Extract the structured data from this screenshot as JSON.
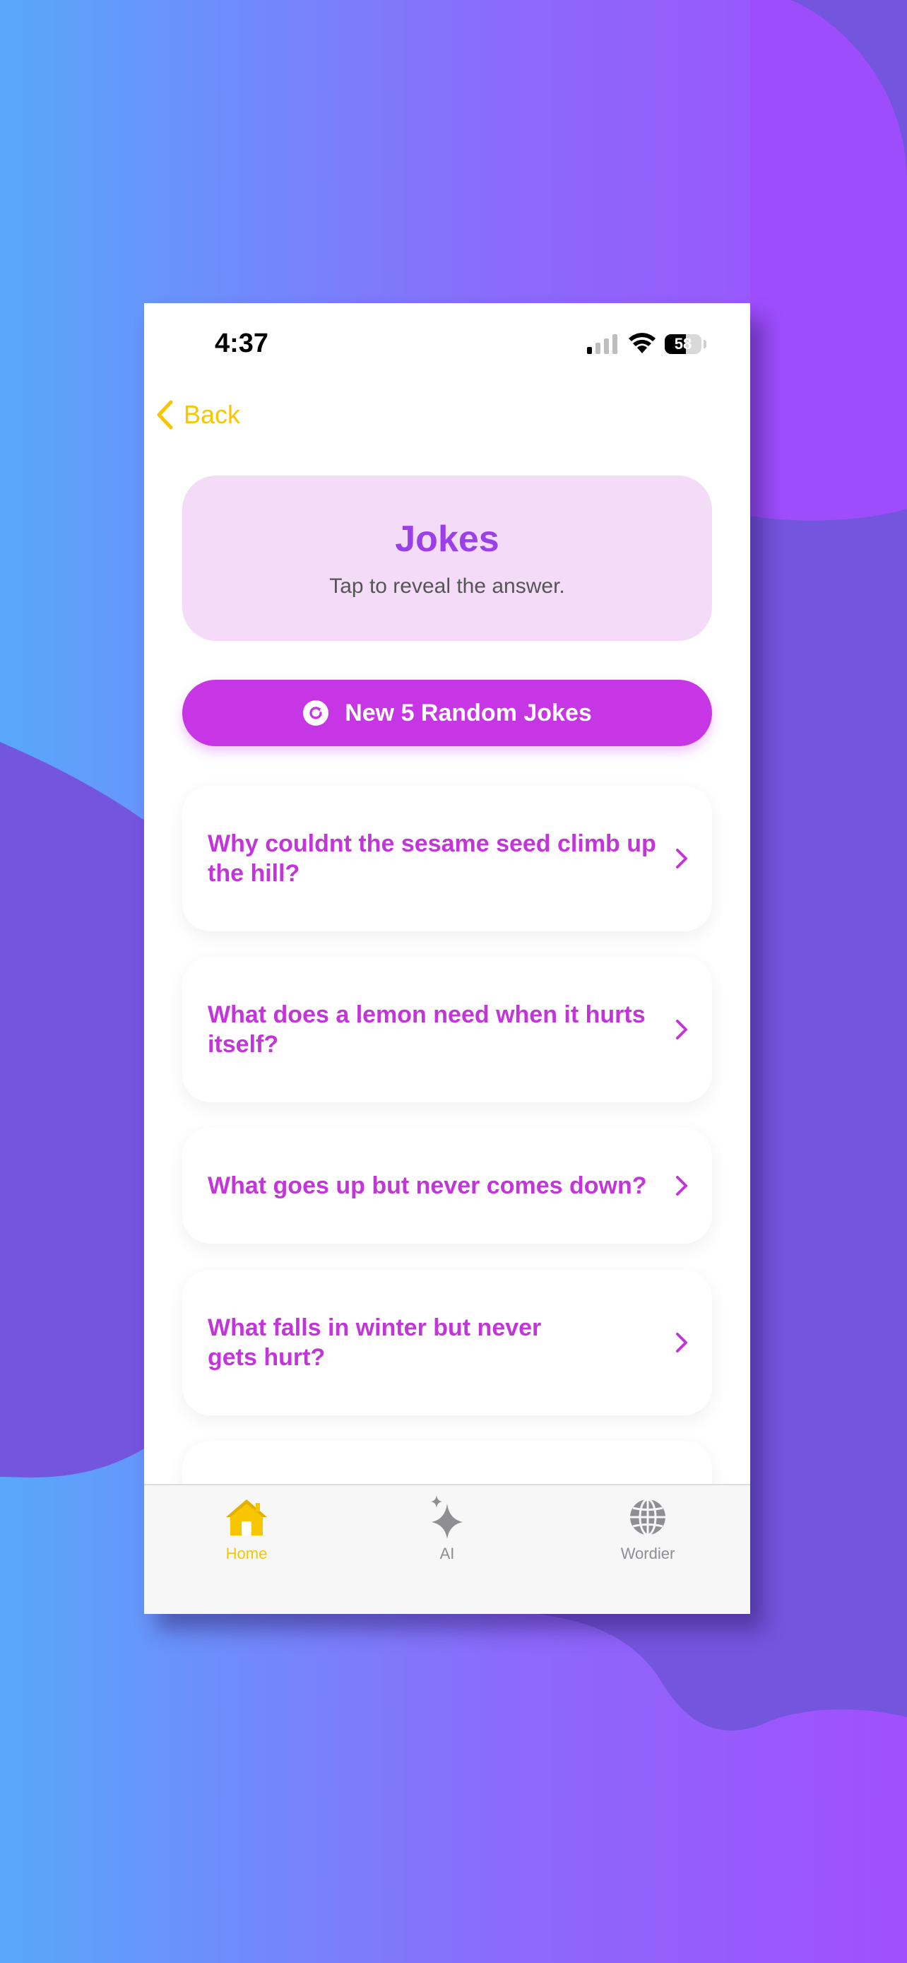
{
  "status_bar": {
    "time": "4:37",
    "battery_percent": 58,
    "battery_label": "58"
  },
  "nav": {
    "back_label": "Back",
    "back_icon": "chevron-left-icon"
  },
  "header": {
    "title": "Jokes",
    "subtitle": "Tap to reveal the answer."
  },
  "random_button": {
    "label": "New 5 Random Jokes",
    "icon": "refresh-icon"
  },
  "jokes": [
    {
      "question": "Why couldnt the sesame seed climb up the hill?"
    },
    {
      "question": "What does a lemon need when it hurts itself?"
    },
    {
      "question": "What goes up but never comes down?"
    },
    {
      "question": "What falls in winter but never gets hurt?"
    },
    {
      "question": ""
    }
  ],
  "tab_bar": {
    "items": [
      {
        "label": "Home",
        "icon": "house-icon",
        "active": true
      },
      {
        "label": "AI",
        "icon": "sparkles-icon",
        "active": false
      },
      {
        "label": "Wordier",
        "icon": "globe-icon",
        "active": false
      }
    ]
  },
  "colors": {
    "accent_yellow": "#f7c600",
    "accent_purple": "#c736e4",
    "title_purple": "#9b3fe8",
    "header_card_bg": "#f4dcf8",
    "tab_inactive": "#8e8e93"
  }
}
